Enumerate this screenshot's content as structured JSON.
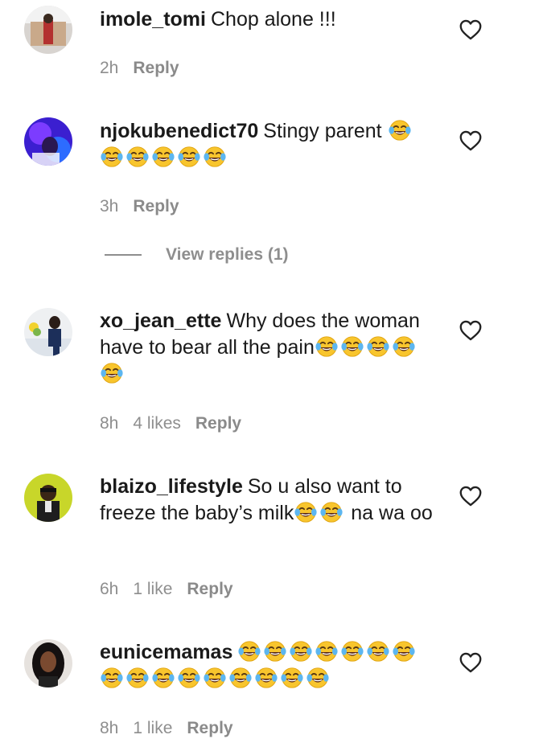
{
  "comments": [
    {
      "username": "imole_tomi",
      "text": "Chop alone !!!",
      "laugh_emojis": 0,
      "time": "2h",
      "likes": "",
      "reply": "Reply"
    },
    {
      "username": "njokubenedict70",
      "text": "Stingy parent",
      "laugh_emojis": 6,
      "time": "3h",
      "likes": "",
      "reply": "Reply"
    },
    {
      "username": "xo_jean_ette",
      "text": "Why does the woman have to bear all the pain",
      "laugh_emojis": 5,
      "time": "8h",
      "likes": "4 likes",
      "reply": "Reply"
    },
    {
      "username": "blaizo_lifestyle",
      "text": "So u also want to freeze the baby’s milk",
      "laugh_emojis": 2,
      "text_after": "na wa oo",
      "time": "6h",
      "likes": "1 like",
      "reply": "Reply"
    },
    {
      "username": "eunicemamas",
      "text": "",
      "laugh_emojis": 16,
      "time": "8h",
      "likes": "1 like",
      "reply": "Reply"
    }
  ],
  "view_replies": "View replies (1)",
  "icons": {
    "like": "heart-outline-icon",
    "emoji": "face-with-tears-of-joy"
  }
}
